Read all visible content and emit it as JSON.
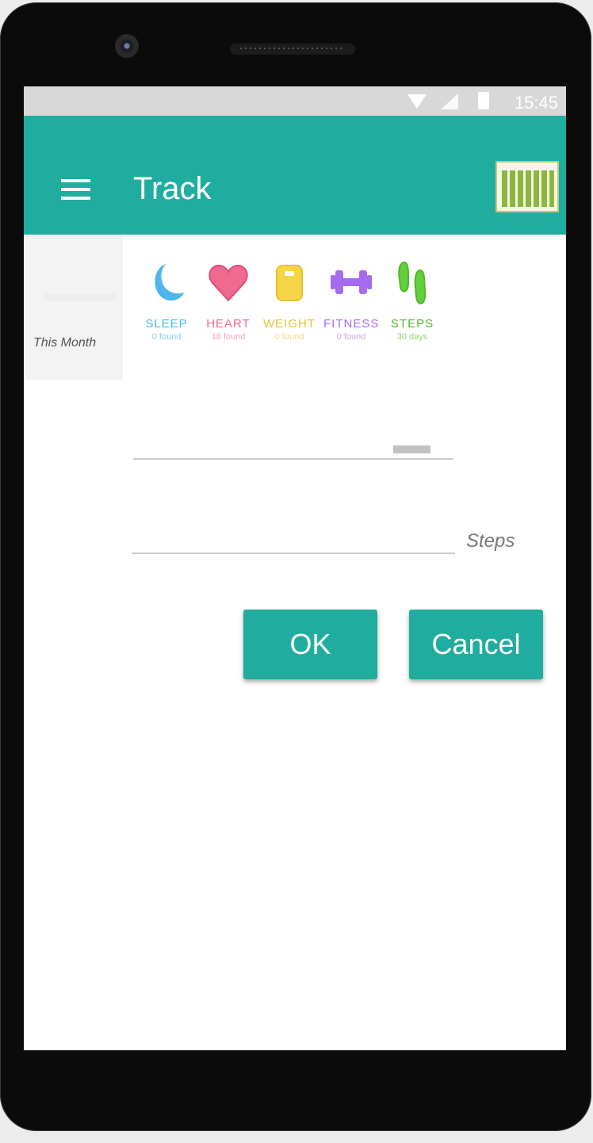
{
  "status_bar": {
    "time": "15:45",
    "icons": [
      "wifi-icon",
      "signal-icon",
      "battery-icon"
    ]
  },
  "app_bar": {
    "title": "Track",
    "menu_icon": "menu-icon",
    "action_icon": "calendar-icon",
    "color": "#20ad9f"
  },
  "background_card": {
    "label": "This Month"
  },
  "trackers": [
    {
      "name": "SLEEP",
      "count": "0 found",
      "icon": "moon-icon",
      "color": "#4db6ec"
    },
    {
      "name": "HEART",
      "count": "18 found",
      "icon": "heart-icon",
      "color": "#f06a8f"
    },
    {
      "name": "WEIGHT",
      "count": "0 found",
      "icon": "scale-icon",
      "color": "#f5d547"
    },
    {
      "name": "FITNESS",
      "count": "0 found",
      "icon": "dumbbell-icon",
      "color": "#a66cf0"
    },
    {
      "name": "STEPS",
      "count": "30 days",
      "icon": "footprints-icon",
      "color": "#62cf3e"
    }
  ],
  "form": {
    "steps_value": "",
    "steps_unit": "Steps"
  },
  "buttons": {
    "ok": "OK",
    "cancel": "Cancel"
  }
}
